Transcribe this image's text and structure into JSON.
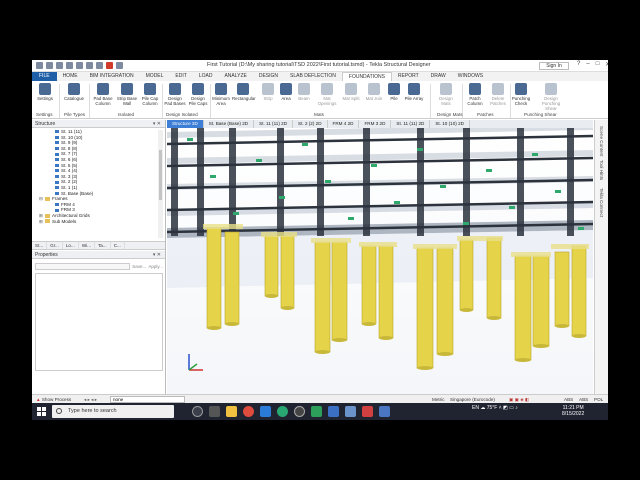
{
  "window": {
    "title": "First Tutorial (D:\\My sharing tutorial\\TSD 2022\\First tutorial.tsmd) - Tekla Structural Designer",
    "sign_in": "Sign In",
    "controls": [
      "?",
      "–",
      "□",
      "✕"
    ]
  },
  "menu_tabs": [
    "FILE",
    "HOME",
    "BIM INTEGRATION",
    "MODEL",
    "EDIT",
    "LOAD",
    "ANALYZE",
    "DESIGN",
    "SLAB DEFLECTION",
    "FOUNDATIONS",
    "REPORT",
    "DRAW",
    "WINDOWS"
  ],
  "active_tab": "FOUNDATIONS",
  "ribbon": {
    "buttons": [
      {
        "label": "Settings",
        "icon": "settings-icon",
        "enabled": true
      },
      {
        "label": "Catalogue",
        "icon": "catalogue-icon",
        "enabled": true
      },
      {
        "label": "Pad Base Column",
        "icon": "pad-base-column-icon",
        "enabled": true
      },
      {
        "label": "Strip Base Wall",
        "icon": "strip-base-wall-icon",
        "enabled": true
      },
      {
        "label": "Pile Cap Column",
        "icon": "pile-cap-column-icon",
        "enabled": true
      },
      {
        "label": "Design Pad Bases",
        "icon": "design-pad-bases-icon",
        "enabled": true
      },
      {
        "label": "Design Pile Caps",
        "icon": "design-pile-caps-icon",
        "enabled": true
      },
      {
        "label": "Minimum Area",
        "icon": "minimum-area-icon",
        "enabled": true
      },
      {
        "label": "Rectangular",
        "icon": "rectangular-icon",
        "enabled": true
      },
      {
        "label": "Strip",
        "icon": "strip-icon",
        "enabled": false
      },
      {
        "label": "Area",
        "icon": "area-icon",
        "enabled": true
      },
      {
        "label": "Beam",
        "icon": "beam-icon",
        "enabled": false
      },
      {
        "label": "Mat Openings",
        "icon": "mat-openings-icon",
        "enabled": false
      },
      {
        "label": "Mat Split",
        "icon": "mat-split-icon",
        "enabled": false
      },
      {
        "label": "Mat Join",
        "icon": "mat-join-icon",
        "enabled": false
      },
      {
        "label": "Pile",
        "icon": "pile-icon",
        "enabled": true
      },
      {
        "label": "Pile Array",
        "icon": "pile-array-icon",
        "enabled": true
      },
      {
        "label": "Design Mats",
        "icon": "design-mats-icon",
        "enabled": false
      },
      {
        "label": "Patch Column",
        "icon": "patch-column-icon",
        "enabled": true
      },
      {
        "label": "Delete Patches",
        "icon": "delete-patches-icon",
        "enabled": false
      },
      {
        "label": "Punching Check",
        "icon": "punching-check-icon",
        "enabled": true
      },
      {
        "label": "Design Punching Shear",
        "icon": "design-punching-shear-icon",
        "enabled": false
      }
    ],
    "groups": [
      "Settings",
      "Pile Types",
      "Isolated",
      "Design Isolated",
      "Mats",
      "Design Mats",
      "Patches",
      "Punching Shear"
    ]
  },
  "structure_panel": {
    "title": "Structure",
    "tree": [
      {
        "label": "St. 11 (11)",
        "indent": 3,
        "type": "level"
      },
      {
        "label": "St. 10 (10)",
        "indent": 3,
        "type": "level"
      },
      {
        "label": "St. 9 (9)",
        "indent": 3,
        "type": "level"
      },
      {
        "label": "St. 8 (8)",
        "indent": 3,
        "type": "level"
      },
      {
        "label": "St. 7 (7)",
        "indent": 3,
        "type": "level"
      },
      {
        "label": "St. 6 (6)",
        "indent": 3,
        "type": "level"
      },
      {
        "label": "St. 5 (5)",
        "indent": 3,
        "type": "level"
      },
      {
        "label": "St. 4 (4)",
        "indent": 3,
        "type": "level"
      },
      {
        "label": "St. 3 (3)",
        "indent": 3,
        "type": "level"
      },
      {
        "label": "St. 2 (2)",
        "indent": 3,
        "type": "level"
      },
      {
        "label": "St. 1 (1)",
        "indent": 3,
        "type": "level"
      },
      {
        "label": "St. Base (Base)",
        "indent": 3,
        "type": "level"
      },
      {
        "label": "Frames",
        "indent": 1,
        "type": "folder",
        "expander": "⊟"
      },
      {
        "label": "FRM 4",
        "indent": 3,
        "type": "level"
      },
      {
        "label": "FRM 3",
        "indent": 3,
        "type": "level"
      },
      {
        "label": "Architectural Grids",
        "indent": 1,
        "type": "folder",
        "expander": "⊞"
      },
      {
        "label": "Sub Models",
        "indent": 1,
        "type": "folder",
        "expander": "⊞"
      }
    ],
    "bottom_tabs": [
      "St...",
      "Gr...",
      "Lo...",
      "Wi...",
      "Ta...",
      "C..."
    ]
  },
  "properties_panel": {
    "title": "Properties",
    "buttons": [
      "Save...",
      "Apply..."
    ]
  },
  "view_tabs": [
    "Structure 3D",
    "St. Base (Base) 2D",
    "St. 11 (11) 2D",
    "St. 2 (2) 2D",
    "FRM 4 2D",
    "FRM 3 2D",
    "St. 11 (11) 2D",
    "St. 10 (10) 2D"
  ],
  "right_strip": [
    "Scene Content",
    "Tool Hints",
    "Tekla Connect"
  ],
  "status": {
    "show_process": "Show Process",
    "none_field": "none",
    "metric": "Metric",
    "code": "Singapore (Eurocode)",
    "flags": [
      "ABS",
      "ABS",
      "POL"
    ]
  },
  "taskbar": {
    "search_placeholder": "Type here to search",
    "weather": "75°F",
    "language": "EN",
    "time": "11:21 PM",
    "date": "8/15/2022"
  },
  "colors": {
    "file_tab": "#1f5fa8",
    "active_view_tab": "#3d7ed6",
    "piles": "#e5d34a",
    "frame_dark": "#2c333d",
    "floor_slab": "#c7ced8"
  }
}
